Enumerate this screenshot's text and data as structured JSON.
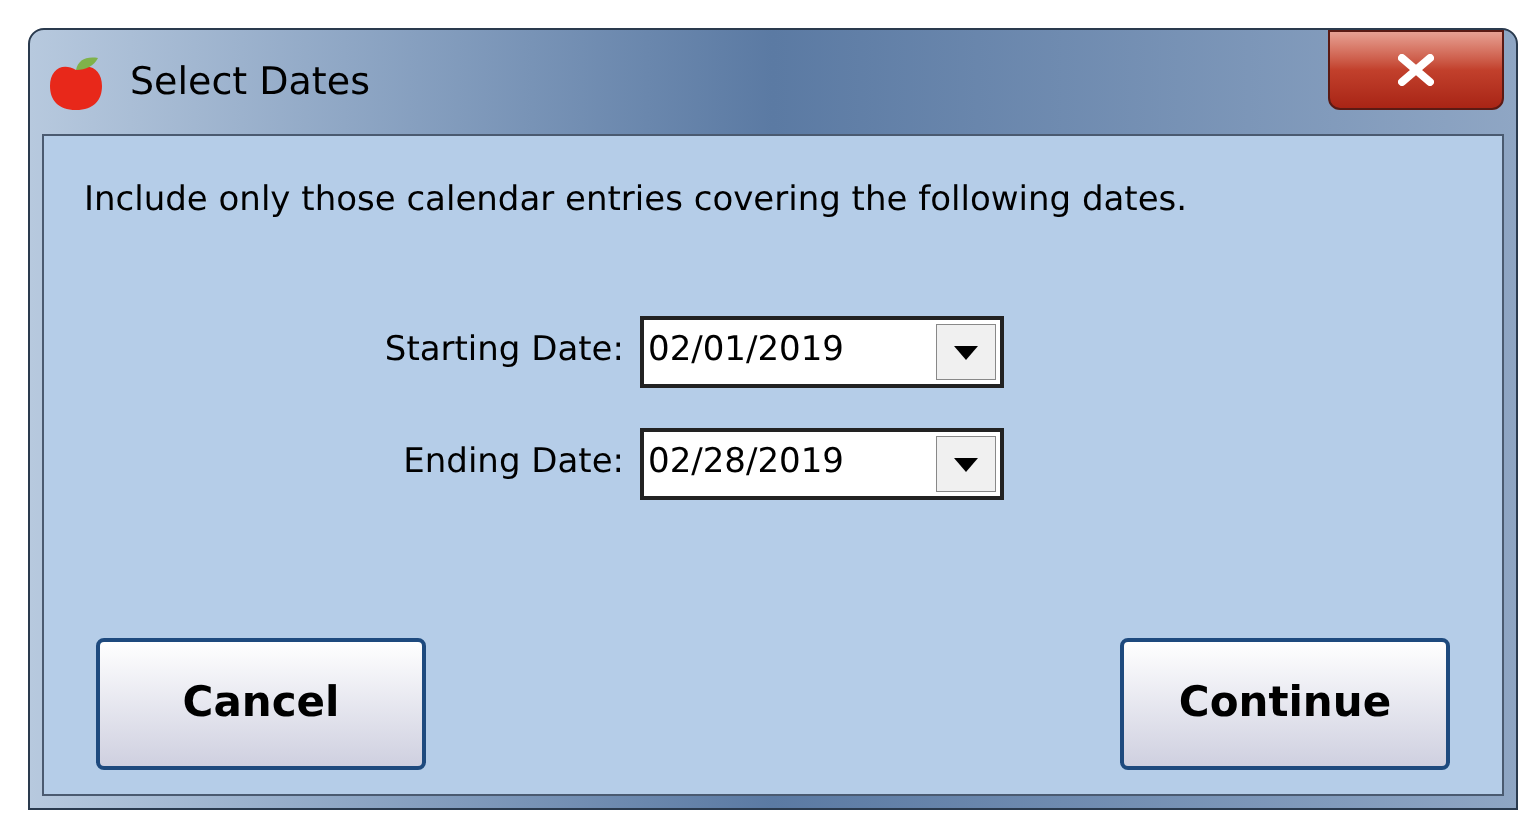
{
  "window": {
    "title": "Select Dates"
  },
  "instruction": "Include only those calendar entries covering the following dates.",
  "fields": [
    {
      "label": "Starting Date:",
      "value": "02/01/2019"
    },
    {
      "label": "Ending Date:",
      "value": "02/28/2019"
    }
  ],
  "buttons": [
    "Cancel",
    "Continue"
  ]
}
